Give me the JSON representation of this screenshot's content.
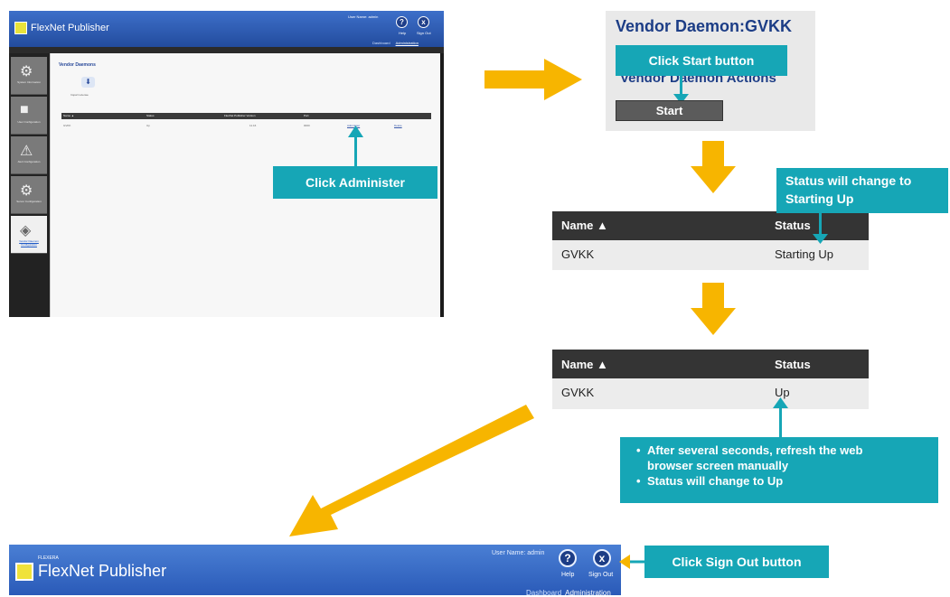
{
  "panel1": {
    "brand": "FlexNet Publisher",
    "user_name": "User Name: admin",
    "help_label": "Help",
    "signout_label": "Sign Out",
    "tabs": [
      "Dashboard",
      "Administration"
    ],
    "sidebar": [
      {
        "label": "System Information",
        "icon": "gear-icon"
      },
      {
        "label": "User Configuration",
        "icon": "user-icon"
      },
      {
        "label": "Alert Configuration",
        "icon": "alert-icon"
      },
      {
        "label": "Server Configuration",
        "icon": "gear-icon"
      },
      {
        "label": "Vendor Daemon Configuration",
        "icon": "plug-icon"
      }
    ],
    "main_title": "Vendor Daemons",
    "import_label": "Import License",
    "columns": [
      "Name ▲",
      "Status",
      "FlexNet Publisher Version",
      "Port"
    ],
    "row": [
      "GVKK",
      "Up",
      "11.16",
      "0000"
    ],
    "row_actions": [
      "Administer",
      "Delete"
    ]
  },
  "callouts": {
    "administer": "Click Administer",
    "start": "Click Start button",
    "status_line1": "Status will change to",
    "status_line2": "Starting Up",
    "refresh_bullet1_line1": "After several seconds, refresh the web",
    "refresh_bullet1_line2": "browser screen manually",
    "refresh_bullet2_prefix": "Status will change to ",
    "refresh_bullet2_value": "Up",
    "signout": "Click Sign Out button"
  },
  "vendor_panel": {
    "title": "Vendor Daemon:GVKK",
    "actions_heading": "Vendor Daemon Actions",
    "start_button": "Start"
  },
  "status_table_1": {
    "col_name": "Name ▲",
    "col_status": "Status",
    "name": "GVKK",
    "status": "Starting Up"
  },
  "status_table_2": {
    "col_name": "Name ▲",
    "col_status": "Status",
    "name": "GVKK",
    "status": "Up"
  },
  "banner": {
    "brand_small": "FLEXERA",
    "brand": "FlexNet Publisher",
    "user_name": "User Name: admin",
    "help_label": "Help",
    "signout_label": "Sign Out",
    "tabs": [
      "Dashboard",
      "Administration"
    ]
  },
  "colors": {
    "callout": "#16a6b6",
    "arrow": "#f7b500",
    "header_blue": "#2a5ab8",
    "title_blue": "#1c3d86"
  }
}
